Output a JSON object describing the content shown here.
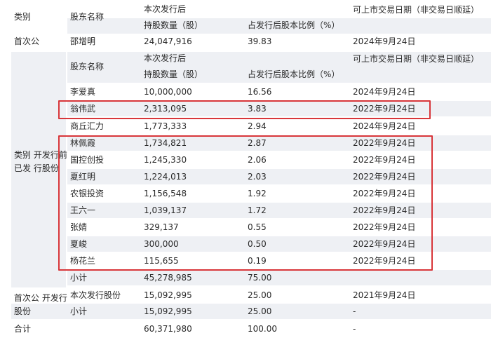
{
  "top_header": {
    "category": "类别",
    "holder": "股东名称",
    "after_issue": "本次发行后",
    "shares": "持股数量（股）",
    "ratio": "占发行后股本比例（%）",
    "tradable_date": "可上市交易日期（非交易日顺延）"
  },
  "first_row": {
    "category": "首次公",
    "name": "邵增明",
    "shares": "24,047,916",
    "ratio": "39.83",
    "date": "2024年9月24日"
  },
  "inner_header": {
    "holder": "股东名称",
    "after_issue": "本次发行后",
    "shares": "持股数量（股）",
    "ratio": "占发行后股本比例（%）",
    "tradable_date": "可上市交易日期（非交易日顺延）"
  },
  "group_label": "类别 开发行前已发 行股份",
  "rows": [
    {
      "name": "李爱真",
      "shares": "10,000,000",
      "ratio": "16.56",
      "date": "2024年9月24日"
    },
    {
      "name": "翁伟武",
      "shares": "2,313,095",
      "ratio": "3.83",
      "date": "2022年9月24日"
    },
    {
      "name": "商丘汇力",
      "shares": "1,773,333",
      "ratio": "2.94",
      "date": "2024年9月24日"
    },
    {
      "name": "林佩霞",
      "shares": "1,734,821",
      "ratio": "2.87",
      "date": "2022年9月24日"
    },
    {
      "name": "国控创投",
      "shares": "1,245,330",
      "ratio": "2.06",
      "date": "2022年9月24日"
    },
    {
      "name": "夏红明",
      "shares": "1,224,013",
      "ratio": "2.03",
      "date": "2022年9月24日"
    },
    {
      "name": "农银投资",
      "shares": "1,156,548",
      "ratio": "1.92",
      "date": "2022年9月24日"
    },
    {
      "name": "王六一",
      "shares": "1,039,137",
      "ratio": "1.72",
      "date": "2022年9月24日"
    },
    {
      "name": "张婧",
      "shares": "329,137",
      "ratio": "0.55",
      "date": "2022年9月24日"
    },
    {
      "name": "夏峻",
      "shares": "300,000",
      "ratio": "0.50",
      "date": "2022年9月24日"
    },
    {
      "name": "杨花兰",
      "shares": "115,655",
      "ratio": "0.19",
      "date": "2022年9月24日"
    }
  ],
  "subtotal1": {
    "name": "小计",
    "shares": "45,278,985",
    "ratio": "75.00"
  },
  "ipo_group": {
    "label": "首次公 开发行 股份",
    "issue": {
      "name": "本次发行股份",
      "shares": "15,092,995",
      "ratio": "25.00",
      "date": "2021年9月24日"
    },
    "subtotal": {
      "name": "小计",
      "shares": "15,092,995",
      "ratio": "25.00",
      "date": "-"
    }
  },
  "total": {
    "label": "合计",
    "shares": "60,371,980",
    "ratio": "100.00",
    "date": "-"
  },
  "colors": {
    "band": "#eef0f4",
    "highlight_border": "#d8363a",
    "text": "#2a2a2a"
  }
}
